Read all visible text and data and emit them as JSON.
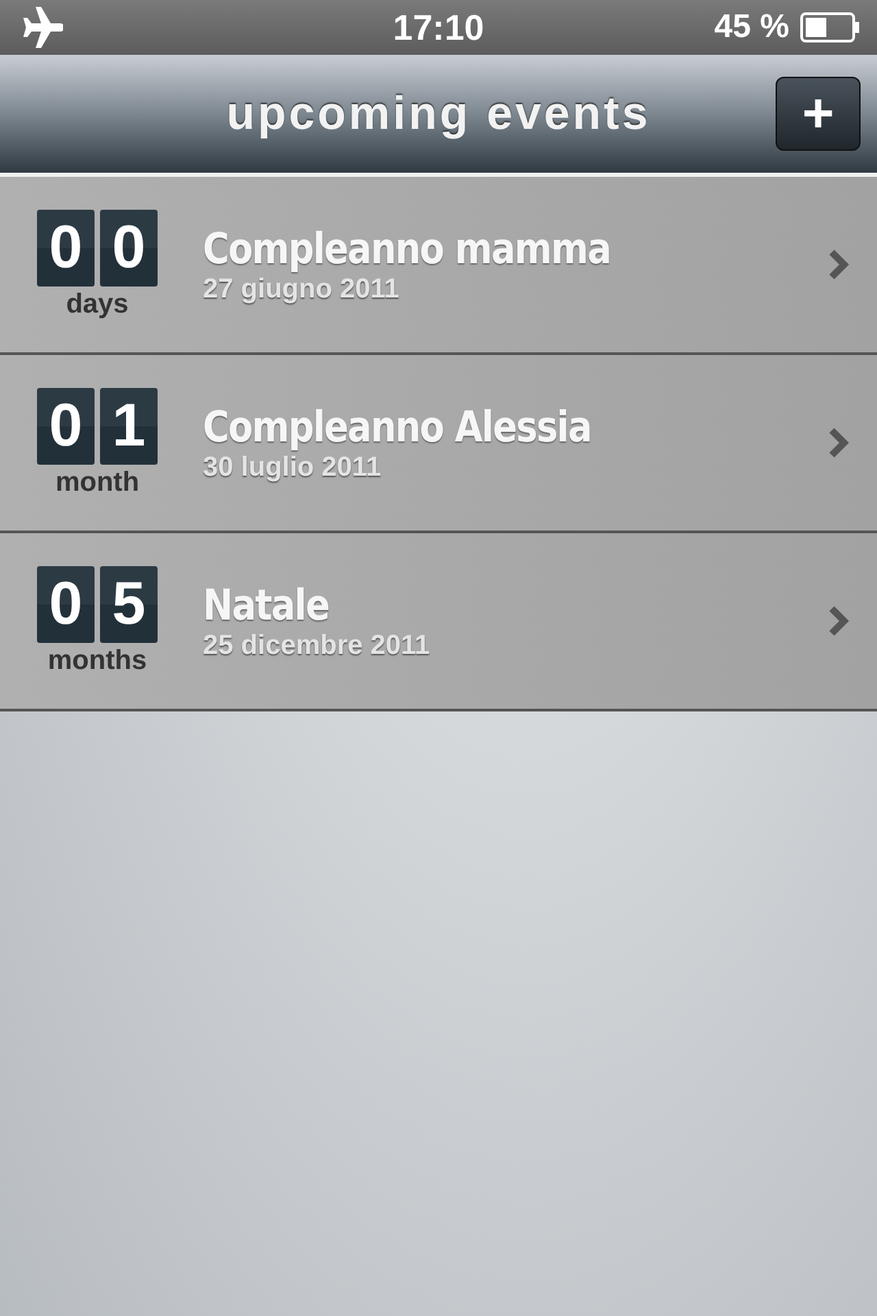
{
  "status_bar": {
    "time": "17:10",
    "battery": "45 %"
  },
  "nav_bar": {
    "title": "upcoming events",
    "add_button": "+"
  },
  "events": [
    {
      "digits": [
        "0",
        "0"
      ],
      "unit": "days",
      "name": "Compleanno mamma",
      "date": "27 giugno 2011"
    },
    {
      "digits": [
        "0",
        "1"
      ],
      "unit": "month",
      "name": "Compleanno Alessia",
      "date": "30 luglio 2011"
    },
    {
      "digits": [
        "0",
        "5"
      ],
      "unit": "months",
      "name": "Natale",
      "date": "25 dicembre 2011"
    }
  ]
}
